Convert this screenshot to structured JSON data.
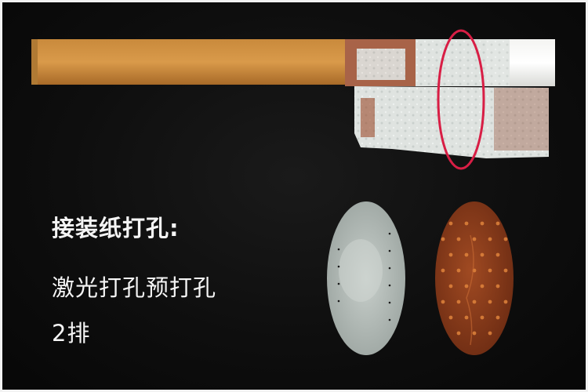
{
  "photo": {
    "subject": "cigarette with tipping paper partially unrolled",
    "background_color": "#0d0d0d"
  },
  "caption": {
    "title": "接装纸打孔:",
    "line2": "激光打孔预打孔",
    "line3": "2排"
  },
  "highlight": {
    "color": "#d81e45"
  },
  "samples": {
    "laser_sample_color": "#b8c0bc",
    "pre_perforated_sample_color": "#8a3d1c"
  }
}
